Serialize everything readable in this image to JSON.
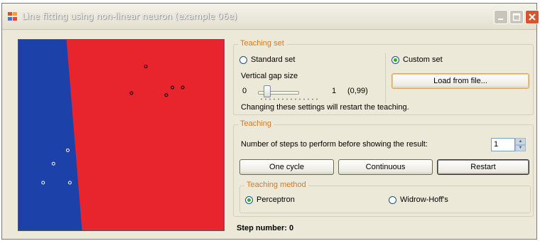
{
  "window": {
    "title": "Line fitting using non-linear neuron (example 06e)"
  },
  "plot": {
    "left_region_color": "#1c41a8",
    "right_region_color": "#e8242d",
    "points": [
      {
        "x": 0.62,
        "y": 0.86,
        "class": "red"
      },
      {
        "x": 0.55,
        "y": 0.72,
        "class": "red"
      },
      {
        "x": 0.72,
        "y": 0.71,
        "class": "red"
      },
      {
        "x": 0.75,
        "y": 0.75,
        "class": "red"
      },
      {
        "x": 0.8,
        "y": 0.75,
        "class": "red"
      },
      {
        "x": 0.24,
        "y": 0.42,
        "class": "blue"
      },
      {
        "x": 0.17,
        "y": 0.35,
        "class": "blue"
      },
      {
        "x": 0.12,
        "y": 0.25,
        "class": "blue"
      },
      {
        "x": 0.25,
        "y": 0.25,
        "class": "blue"
      }
    ]
  },
  "teaching_set": {
    "group_title": "Teaching set",
    "standard_label": "Standard set",
    "custom_label": "Custom set",
    "selected": "custom",
    "vertical_gap_label": "Vertical gap size",
    "slider_min": "0",
    "slider_max": "1",
    "slider_value_text": "(0,99)",
    "slider_value": 0.99,
    "load_button": "Load from file...",
    "note": "Changing these settings will restart the teaching."
  },
  "teaching": {
    "group_title": "Teaching",
    "steps_label": "Number of steps to perform before showing the result:",
    "steps_value": "1",
    "one_cycle_button": "One cycle",
    "continuous_button": "Continuous",
    "restart_button": "Restart"
  },
  "teaching_method": {
    "group_title": "Teaching method",
    "perceptron_label": "Perceptron",
    "widrow_label": "Widrow-Hoff's",
    "selected": "perceptron"
  },
  "status": {
    "step_number": "Step number: 0"
  }
}
